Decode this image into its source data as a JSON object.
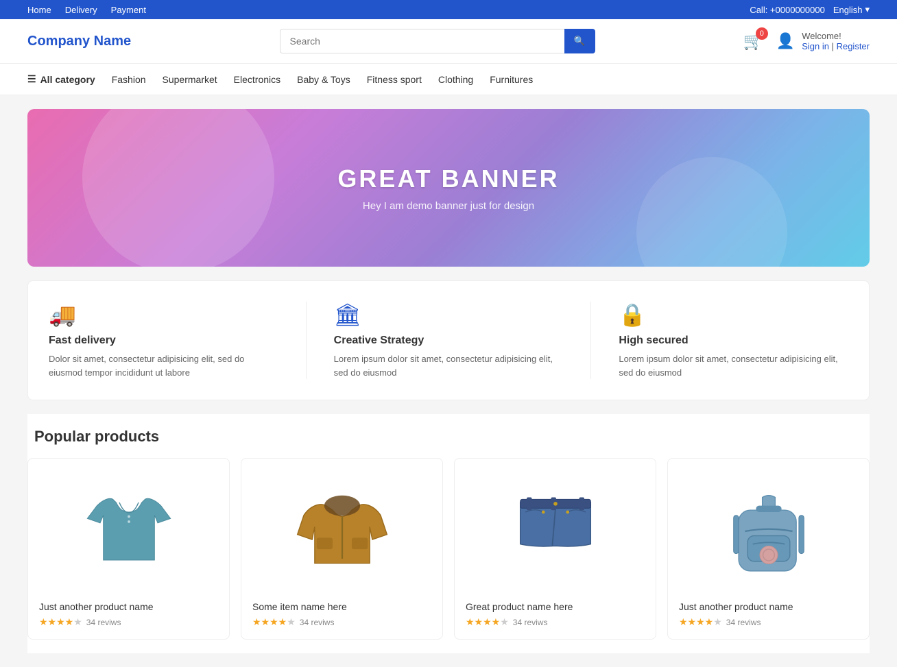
{
  "topbar": {
    "nav": [
      {
        "label": "Home",
        "href": "#"
      },
      {
        "label": "Delivery",
        "href": "#"
      },
      {
        "label": "Payment",
        "href": "#"
      }
    ],
    "call": "Call: +0000000000",
    "language": "English"
  },
  "header": {
    "logo": "Company Name",
    "search_placeholder": "Search",
    "cart_count": "0",
    "welcome": "Welcome!",
    "sign_in": "Sign in",
    "register": "Register"
  },
  "nav": {
    "all_category": "All category",
    "items": [
      {
        "label": "Fashion"
      },
      {
        "label": "Supermarket"
      },
      {
        "label": "Electronics"
      },
      {
        "label": "Baby &amp; Toys"
      },
      {
        "label": "Fitness sport"
      },
      {
        "label": "Clothing"
      },
      {
        "label": "Furnitures"
      }
    ]
  },
  "banner": {
    "title": "GREAT BANNER",
    "subtitle": "Hey I am demo banner just for design"
  },
  "features": [
    {
      "icon": "🚚",
      "title": "Fast delivery",
      "desc": "Dolor sit amet, consectetur adipisicing elit, sed do eiusmod tempor incididunt ut labore"
    },
    {
      "icon": "🏛",
      "title": "Creative Strategy",
      "desc": "Lorem ipsum dolor sit amet, consectetur adipisicing elit, sed do eiusmod"
    },
    {
      "icon": "🔒",
      "title": "High secured",
      "desc": "Lorem ipsum dolor sit amet, consectetur adipisicing elit, sed do eiusmod"
    }
  ],
  "popular_products": {
    "title": "Popular products",
    "items": [
      {
        "name": "Just another product name",
        "rating": 4,
        "reviews": "34 reviws",
        "type": "shirt"
      },
      {
        "name": "Some item name here",
        "rating": 4,
        "reviews": "34 reviws",
        "type": "jacket"
      },
      {
        "name": "Great product name here",
        "rating": 4,
        "reviews": "34 reviws",
        "type": "shorts"
      },
      {
        "name": "Just another product name",
        "rating": 4,
        "reviews": "34 reviws",
        "type": "backpack"
      }
    ]
  }
}
